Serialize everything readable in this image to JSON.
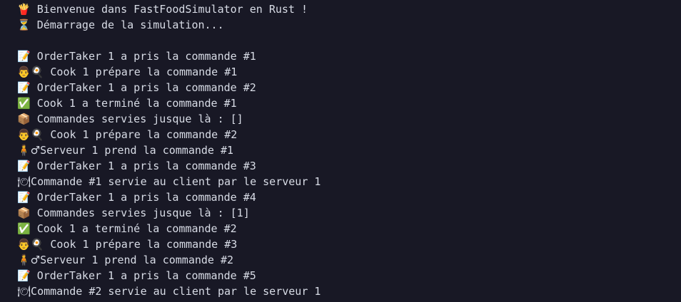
{
  "terminal": {
    "lines": [
      {
        "icon": "🍟",
        "icon_name": "fries-icon",
        "text": " Bienvenue dans FastFoodSimulator en Rust !"
      },
      {
        "icon": "⏳",
        "icon_name": "hourglass-icon",
        "text": " Démarrage de la simulation..."
      },
      {
        "icon": "",
        "icon_name": "",
        "text": ""
      },
      {
        "icon": "📝",
        "icon_name": "memo-icon",
        "text": " OrderTaker 1 a pris la commande #1"
      },
      {
        "icon": "👨🍳",
        "icon_name": "cook-icon",
        "text": " Cook 1 prépare la commande #1"
      },
      {
        "icon": "📝",
        "icon_name": "memo-icon",
        "text": " OrderTaker 1 a pris la commande #2"
      },
      {
        "icon": "✅",
        "icon_name": "check-icon",
        "text": " Cook 1 a terminé la commande #1"
      },
      {
        "icon": "📦",
        "icon_name": "package-icon",
        "text": " Commandes servies jusque là : []"
      },
      {
        "icon": "👨🍳",
        "icon_name": "cook-icon",
        "text": " Cook 1 prépare la commande #2"
      },
      {
        "icon": "🧍♂",
        "icon_name": "waiter-icon",
        "text": "Serveur 1 prend la commande #1"
      },
      {
        "icon": "📝",
        "icon_name": "memo-icon",
        "text": " OrderTaker 1 a pris la commande #3"
      },
      {
        "icon": "🍽",
        "icon_name": "plate-icon",
        "text": "Commande #1 servie au client par le serveur 1"
      },
      {
        "icon": "📝",
        "icon_name": "memo-icon",
        "text": " OrderTaker 1 a pris la commande #4"
      },
      {
        "icon": "📦",
        "icon_name": "package-icon",
        "text": " Commandes servies jusque là : [1]"
      },
      {
        "icon": "✅",
        "icon_name": "check-icon",
        "text": " Cook 1 a terminé la commande #2"
      },
      {
        "icon": "👨🍳",
        "icon_name": "cook-icon",
        "text": " Cook 1 prépare la commande #3"
      },
      {
        "icon": "🧍♂",
        "icon_name": "waiter-icon",
        "text": "Serveur 1 prend la commande #2"
      },
      {
        "icon": "📝",
        "icon_name": "memo-icon",
        "text": " OrderTaker 1 a pris la commande #5"
      },
      {
        "icon": "🍽",
        "icon_name": "plate-icon",
        "text": "Commande #2 servie au client par le serveur 1"
      }
    ]
  }
}
